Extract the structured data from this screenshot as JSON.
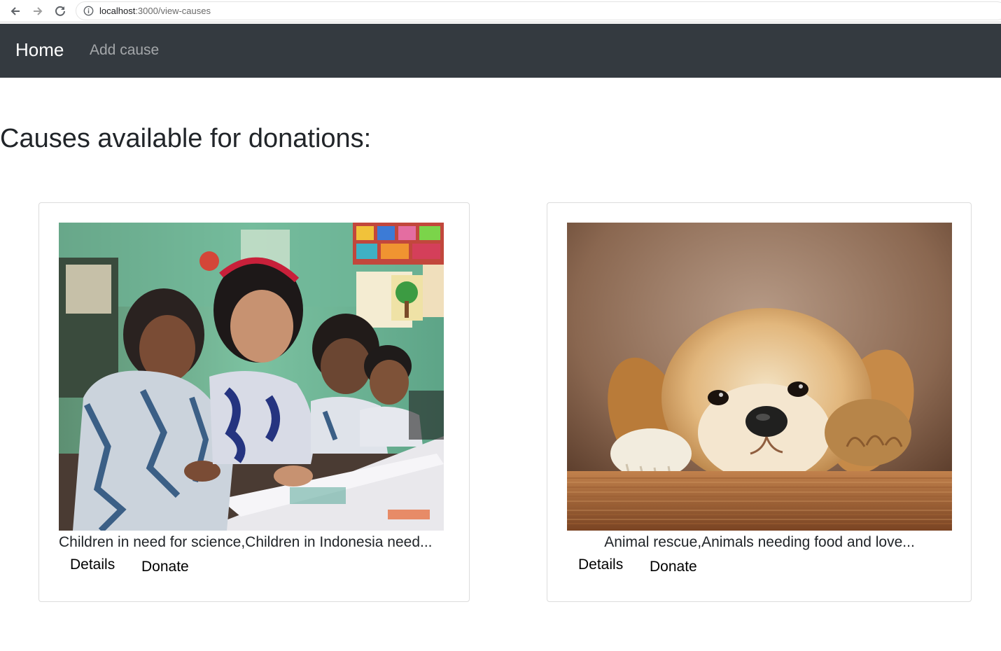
{
  "browser": {
    "url_host": "localhost",
    "url_path": ":3000/view-causes"
  },
  "navbar": {
    "brand": "Home",
    "links": [
      {
        "label": "Add cause"
      }
    ]
  },
  "page": {
    "title": "Causes available for donations:"
  },
  "causes": [
    {
      "image": "children-studying-photo",
      "summary": "Children in need for science,Children in Indonesia need...",
      "details_label": "Details",
      "donate_label": "Donate"
    },
    {
      "image": "puppy-photo",
      "summary": "Animal rescue,Animals needing food and love...",
      "details_label": "Details",
      "donate_label": "Donate"
    }
  ],
  "colors": {
    "navbar_bg": "#343a40",
    "brand_text": "#ffffff",
    "nav_link_text": "rgba(255,255,255,0.55)",
    "body_text": "#212529"
  }
}
